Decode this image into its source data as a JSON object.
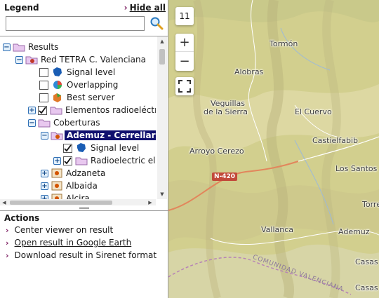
{
  "legend": {
    "title": "Legend",
    "hide_all_label": "Hide all",
    "search": {
      "placeholder": "",
      "value": ""
    }
  },
  "tree": {
    "root": {
      "label": "Results"
    },
    "network": {
      "label": "Red TETRA C. Valenciana"
    },
    "signal_level": {
      "label": "Signal level"
    },
    "overlapping": {
      "label": "Overlapping"
    },
    "best_server": {
      "label": "Best server"
    },
    "elements": {
      "label": "Elementos radioeléctricos"
    },
    "coberturas": {
      "label": "Coberturas"
    },
    "selected": {
      "label": "Ademuz - Cerrellar"
    },
    "selected_signal": {
      "label": "Signal level"
    },
    "selected_radio": {
      "label": "Radioelectric elements"
    },
    "adzaneta": {
      "label": "Adzaneta"
    },
    "albaida": {
      "label": "Albaida"
    },
    "alcira": {
      "label": "Alcira"
    }
  },
  "actions": {
    "title": "Actions",
    "items": [
      {
        "label": "Center viewer on result"
      },
      {
        "label": "Open result in Google Earth"
      },
      {
        "label": "Download result in Sirenet format"
      }
    ]
  },
  "map": {
    "zoom_level": "11",
    "zoom_in": "+",
    "zoom_out": "−",
    "road": "N-420",
    "region": "COMUNIDAD VALENCIANA",
    "places": {
      "tormon": "Tormón",
      "alobras": "Alobras",
      "veguillas_1": "Veguillas",
      "veguillas_2": "de la Sierra",
      "el_cuervo": "El Cuervo",
      "castielfabib": "Castielfabib",
      "arroyo_cerezo": "Arroyo Cerezo",
      "los_santos": "Los Santos",
      "torre": "Torre",
      "vallanca": "Vallanca",
      "ademuz": "Ademuz",
      "casas_1": "Casas",
      "casas_2": "Casas"
    }
  },
  "colors": {
    "selection": "#10106e",
    "accent_chevron": "#7a1a5e",
    "road_label": "#c24a3a"
  }
}
